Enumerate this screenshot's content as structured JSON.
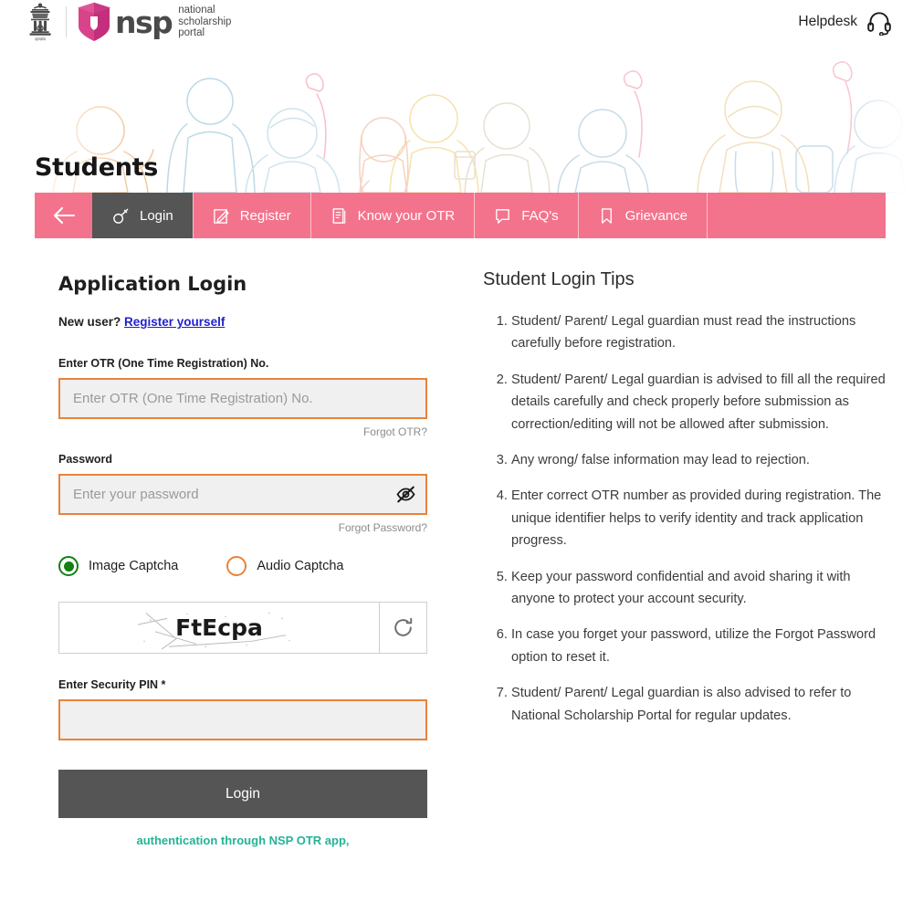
{
  "header": {
    "emblem_icon": "india-national-emblem",
    "emblem_caption": "सत्यमेव जयते",
    "logo": {
      "shield_icon": "nsp-shield-graduation-cap",
      "wordmark": "nsp",
      "line1": "national",
      "line2": "scholarship",
      "line3": "portal"
    },
    "helpdesk_label": "Helpdesk",
    "helpdesk_icon": "headset-icon"
  },
  "hero": {
    "title": "Students"
  },
  "nav": {
    "back_icon": "arrow-left-icon",
    "tabs": [
      {
        "label": "Login",
        "icon": "key-icon",
        "active": true
      },
      {
        "label": "Register",
        "icon": "edit-pencil-icon",
        "active": false
      },
      {
        "label": "Know your OTR",
        "icon": "document-icon",
        "active": false
      },
      {
        "label": "FAQ's",
        "icon": "chat-bubble-icon",
        "active": false
      },
      {
        "label": "Grievance",
        "icon": "bookmark-icon",
        "active": false
      }
    ]
  },
  "login_form": {
    "title": "Application Login",
    "new_user_text": "New user? ",
    "register_link": "Register yourself",
    "otr": {
      "label": "Enter OTR (One Time Registration) No.",
      "placeholder": "Enter OTR (One Time Registration) No.",
      "value": "",
      "forgot": "Forgot OTR?"
    },
    "password": {
      "label": "Password",
      "placeholder": "Enter your password",
      "value": "",
      "forgot": "Forgot Password?",
      "toggle_icon": "eye-slash-icon"
    },
    "captcha_type": {
      "image_label": "Image Captcha",
      "image_selected": true,
      "audio_label": "Audio Captcha",
      "audio_selected": false
    },
    "captcha": {
      "text": "FtEcpa",
      "refresh_icon": "refresh-icon"
    },
    "pin": {
      "label": "Enter Security PIN *",
      "placeholder": "",
      "value": ""
    },
    "submit_label": "Login",
    "bottom_note": "authentication through NSP OTR app,"
  },
  "tips": {
    "title": "Student Login Tips",
    "items": [
      "Student/ Parent/ Legal guardian must read the instructions carefully before registration.",
      "Student/ Parent/ Legal guardian is advised to fill all the required details carefully and check properly before submission as correction/editing will not be allowed after submission.",
      "Any wrong/ false information may lead to rejection.",
      "Enter correct OTR number as provided during registration. The unique identifier helps to verify identity and track application progress.",
      "Keep your password confidential and avoid sharing it with anyone to protect your account security.",
      "In case you forget your password, utilize the Forgot Password option to reset it.",
      "Student/ Parent/ Legal guardian is also advised to refer to National Scholarship Portal for regular updates."
    ]
  },
  "colors": {
    "brand_pink": "#f4738c",
    "active_tab_gray": "#555555",
    "input_border_orange": "#e8833a",
    "input_fill": "#f0f0f0",
    "radio_selected_green": "#128012",
    "link_blue": "#2222cc",
    "note_teal": "#23b396"
  }
}
